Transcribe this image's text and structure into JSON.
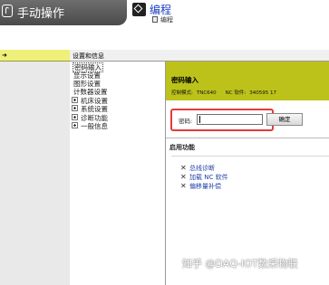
{
  "header": {
    "mode_label": "手动操作",
    "program_label": "编程",
    "program_sub_label": "编程"
  },
  "panel": {
    "title": "设置和信息"
  },
  "tree": {
    "items": [
      {
        "label": "密码输入",
        "expandable": false,
        "selected": true
      },
      {
        "label": "显示设置",
        "expandable": false
      },
      {
        "label": "图形设置",
        "expandable": false
      },
      {
        "label": "计数器设置",
        "expandable": false
      },
      {
        "label": "机床设置",
        "expandable": true
      },
      {
        "label": "系统设置",
        "expandable": true
      },
      {
        "label": "诊断功能",
        "expandable": true
      },
      {
        "label": "一般信息",
        "expandable": true
      }
    ]
  },
  "content": {
    "title": "密码输入",
    "control_model_label": "控制模式:",
    "control_model_value": "TNC640",
    "nc_software_label": "NC 软件:",
    "nc_software_value": "340595 17",
    "password_label": "密码:",
    "password_value": "",
    "ok_button": "确定",
    "functions_title": "启用功能",
    "functions": [
      {
        "label": "总线诊断"
      },
      {
        "label": "加载 NC 软件"
      },
      {
        "label": "偏移量补偿"
      }
    ]
  },
  "watermark": "知乎 @DAQ-IOT数采物联",
  "colors": {
    "header_bar": "#5a5a5a",
    "olive_bar": "#bcc21a",
    "rail_header": "#eef07a",
    "highlight_box": "#e53a3a",
    "link_blue": "#1f3fa8"
  }
}
